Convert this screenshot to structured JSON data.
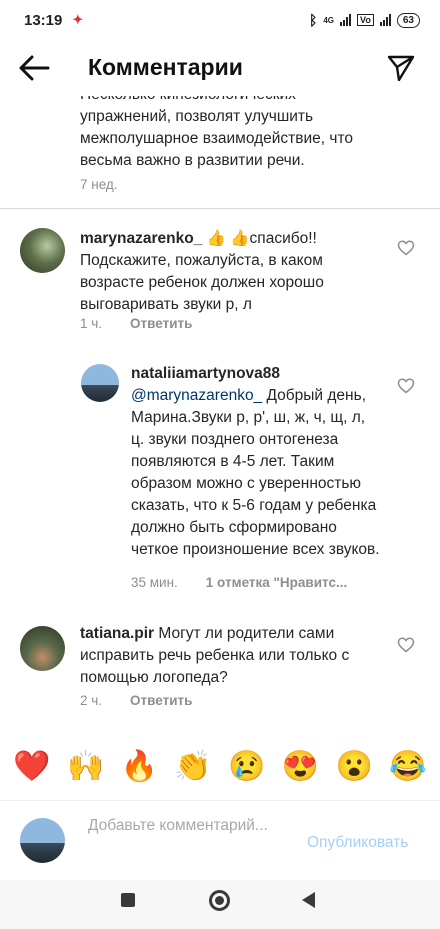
{
  "status": {
    "time": "13:19",
    "battery": "63",
    "network": "4G"
  },
  "header": {
    "title": "Комментарии"
  },
  "comments": {
    "first": {
      "text": "Несколько кинезиологических упражнений,  позволят улучшить межполушарное взаимодействие, что весьма важно в развитии речи.",
      "time": "7 нед."
    },
    "c1": {
      "user": "marynazarenko_",
      "text": " 👍 👍спасибо!! Подскажите, пожалуйста, в каком возрасте ребенок должен хорошо выговаривать звуки р, л",
      "time": "1 ч.",
      "reply": "Ответить"
    },
    "c2": {
      "user": "nataliiamartynova88",
      "mention": "@marynazarenko_",
      "text": " Добрый день, Марина.Звуки р, р', ш, ж, ч, щ, л, ц. звуки позднего онтогенеза появляются в 4-5 лет. Таким образом можно с уверенностью сказать, что к 5-6 годам у ребенка должно быть сформировано четкое произношение всех звуков.",
      "time": "35 мин.",
      "likes": "1 отметка \"Нравитс..."
    },
    "c3": {
      "user": "tatiana.pir",
      "text": " Могут ли родители сами исправить речь ребенка или только с помощью логопеда?",
      "time": "2 ч.",
      "reply": "Ответить"
    }
  },
  "emojis": [
    "❤️",
    "🙌",
    "🔥",
    "👏",
    "😢",
    "😍",
    "😮",
    "😂"
  ],
  "compose": {
    "placeholder": "Добавьте комментарий...",
    "publish": "Опубликовать"
  }
}
